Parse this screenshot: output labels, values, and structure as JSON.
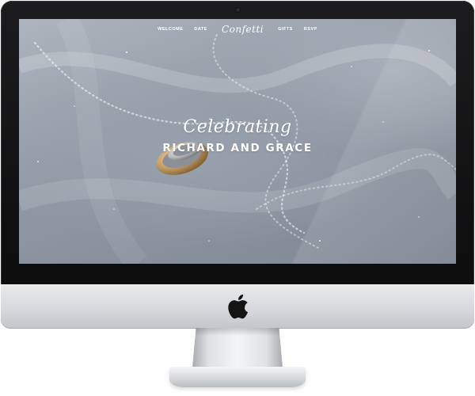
{
  "nav": {
    "items": [
      "WELCOME",
      "DATE",
      "GIFTS",
      "RSVP"
    ],
    "logo": "Confetti"
  },
  "hero": {
    "script_line": "Celebrating",
    "names": "RICHARD AND GRACE"
  },
  "icons": {
    "brand": "apple-logo-icon"
  },
  "colors": {
    "bezel": "#111113",
    "screen_bg": "#8f97a3",
    "hero_text": "#ffffff",
    "ring_gold": "#c9a16b"
  }
}
